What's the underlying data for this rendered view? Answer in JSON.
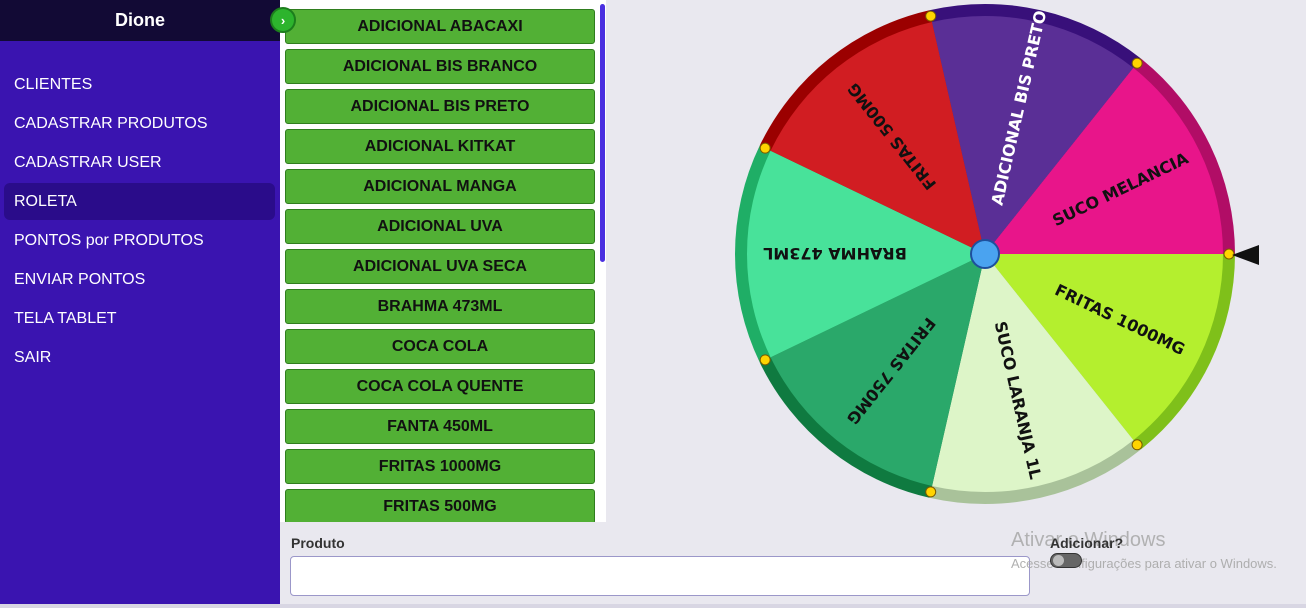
{
  "sidebar": {
    "title": "Dione",
    "items": [
      {
        "label": "CLIENTES",
        "active": false
      },
      {
        "label": "CADASTRAR PRODUTOS",
        "active": false
      },
      {
        "label": "CADASTRAR USER",
        "active": false
      },
      {
        "label": "ROLETA",
        "active": true
      },
      {
        "label": "PONTOS por PRODUTOS",
        "active": false
      },
      {
        "label": "ENVIAR PONTOS",
        "active": false
      },
      {
        "label": "TELA TABLET",
        "active": false
      },
      {
        "label": "SAIR",
        "active": false
      }
    ]
  },
  "toggle_icon": "chevron-right-icon",
  "products": [
    "ADICIONAL ABACAXI",
    "ADICIONAL BIS BRANCO",
    "ADICIONAL BIS PRETO",
    "ADICIONAL KITKAT",
    "ADICIONAL MANGA",
    "ADICIONAL UVA",
    "ADICIONAL UVA SECA",
    "BRAHMA 473ML",
    "COCA COLA",
    "COCA COLA QUENTE",
    "FANTA 450ML",
    "FRITAS 1000MG",
    "FRITAS 500MG"
  ],
  "wheel": {
    "segments": [
      {
        "label": "FRITAS 1000MG",
        "color": "#b4ef2e",
        "rim": "#7fc01a",
        "text_color": "#111111"
      },
      {
        "label": "SUCO LARANJA 1L",
        "color": "#ddf5c8",
        "rim": "#a9c29a",
        "text_color": "#111111"
      },
      {
        "label": "FRITAS 750MG",
        "color": "#2aa86a",
        "rim": "#0f7a40",
        "text_color": "#111111"
      },
      {
        "label": "BRAHMA 473ML",
        "color": "#48e29a",
        "rim": "#1fae66",
        "text_color": "#111111"
      },
      {
        "label": "FRITAS 500MG",
        "color": "#d11d22",
        "rim": "#9b0000",
        "text_color": "#111111"
      },
      {
        "label": "ADICIONAL BIS PRETO",
        "color": "#5a2f96",
        "rim": "#38107a",
        "text_color": "#ffffff"
      },
      {
        "label": "SUCO MELANCIA",
        "color": "#e8158a",
        "rim": "#b10d66",
        "text_color": "#111111"
      }
    ],
    "hub_color": "#4aa3f0",
    "peg_color": "#ffd400"
  },
  "form": {
    "produto_label": "Produto",
    "produto_value": "",
    "adicionar_label": "Adicionar?",
    "adicionar_checked": false
  },
  "watermark": {
    "title": "Ativar o Windows",
    "subtitle": "Acesse Configurações para ativar o Windows."
  }
}
